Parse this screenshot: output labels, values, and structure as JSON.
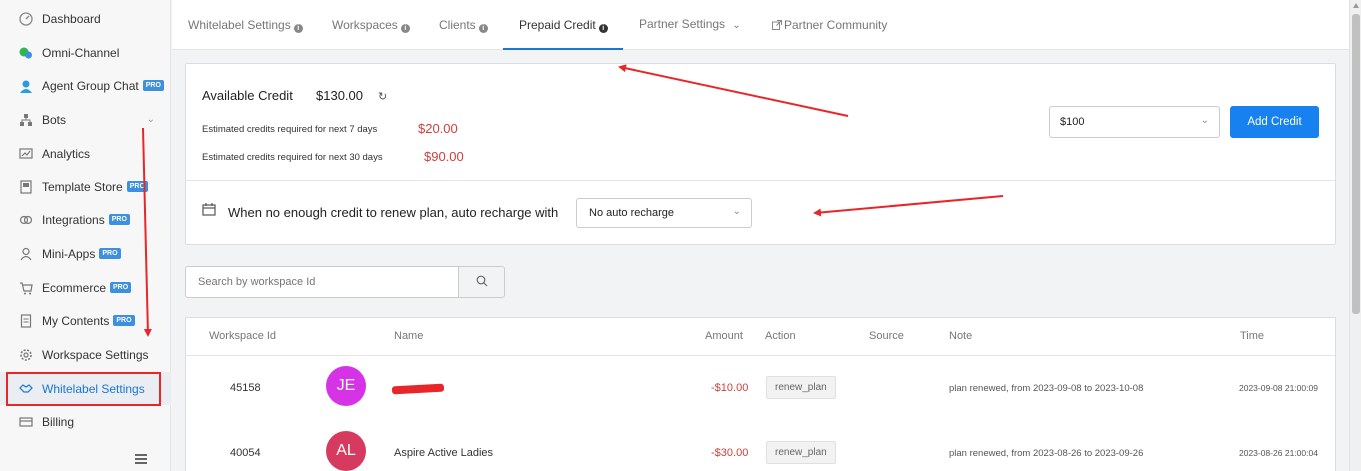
{
  "sidebar": {
    "items": [
      {
        "label": "Dashboard",
        "icon": "gauge-icon",
        "pro": ""
      },
      {
        "label": "Omni-Channel",
        "icon": "chat-bubbles-icon",
        "pro": ""
      },
      {
        "label": "Agent Group Chat",
        "icon": "agent-icon",
        "pro": "PRO"
      },
      {
        "label": "Bots",
        "icon": "hierarchy-icon",
        "pro": ""
      },
      {
        "label": "Analytics",
        "icon": "analytics-icon",
        "pro": ""
      },
      {
        "label": "Template Store",
        "icon": "bookmark-icon",
        "pro": "PRO"
      },
      {
        "label": "Integrations",
        "icon": "integrations-icon",
        "pro": "PRO"
      },
      {
        "label": "Mini-Apps",
        "icon": "user-icon",
        "pro": "PRO"
      },
      {
        "label": "Ecommerce",
        "icon": "cart-icon",
        "pro": "PRO"
      },
      {
        "label": "My Contents",
        "icon": "document-icon",
        "pro": "PRO"
      },
      {
        "label": "Workspace Settings",
        "icon": "gear-icon",
        "pro": ""
      },
      {
        "label": "Whitelabel Settings",
        "icon": "handshake-icon",
        "pro": ""
      },
      {
        "label": "Billing",
        "icon": "card-icon",
        "pro": ""
      }
    ]
  },
  "tabs": [
    {
      "label": "Whitelabel Settings",
      "suffix": "info"
    },
    {
      "label": "Workspaces",
      "suffix": "info"
    },
    {
      "label": "Clients",
      "suffix": "info"
    },
    {
      "label": "Prepaid Credit",
      "suffix": "info",
      "active": true
    },
    {
      "label": "Partner Settings",
      "suffix": "chevron"
    },
    {
      "label": "Partner Community",
      "suffix": "external-link"
    }
  ],
  "credit": {
    "available_label": "Available Credit",
    "available_value": "$130.00",
    "est7_label": "Estimated credits required for next 7 days",
    "est7_value": "$20.00",
    "est30_label": "Estimated credits required for next 30 days",
    "est30_value": "$90.00",
    "amount_selected": "$100",
    "add_button": "Add Credit",
    "recharge_label": "When no enough credit to renew plan, auto recharge with",
    "recharge_selected": "No auto recharge"
  },
  "search": {
    "placeholder": "Search by workspace Id"
  },
  "table": {
    "headers": {
      "workspace_id": "Workspace Id",
      "name": "Name",
      "amount": "Amount",
      "action": "Action",
      "source": "Source",
      "note": "Note",
      "time": "Time"
    },
    "rows": [
      {
        "workspace_id": "45158",
        "initials": "JE",
        "avatar_color": "#d633e6",
        "name": "",
        "amount": "-$10.00",
        "action": "renew_plan",
        "source": "",
        "note": "plan renewed, from 2023-09-08 to 2023-10-08",
        "time": "2023-09-08 21:00:09"
      },
      {
        "workspace_id": "40054",
        "initials": "AL",
        "avatar_color": "#d63a5e",
        "name": "Aspire Active Ladies",
        "amount": "-$30.00",
        "action": "renew_plan",
        "source": "",
        "note": "plan renewed, from 2023-08-26 to 2023-09-26",
        "time": "2023-08-26 21:00:04"
      }
    ]
  },
  "colors": {
    "accent": "#1681ef",
    "negative": "#d0403c",
    "annotation": "#e8262a"
  }
}
